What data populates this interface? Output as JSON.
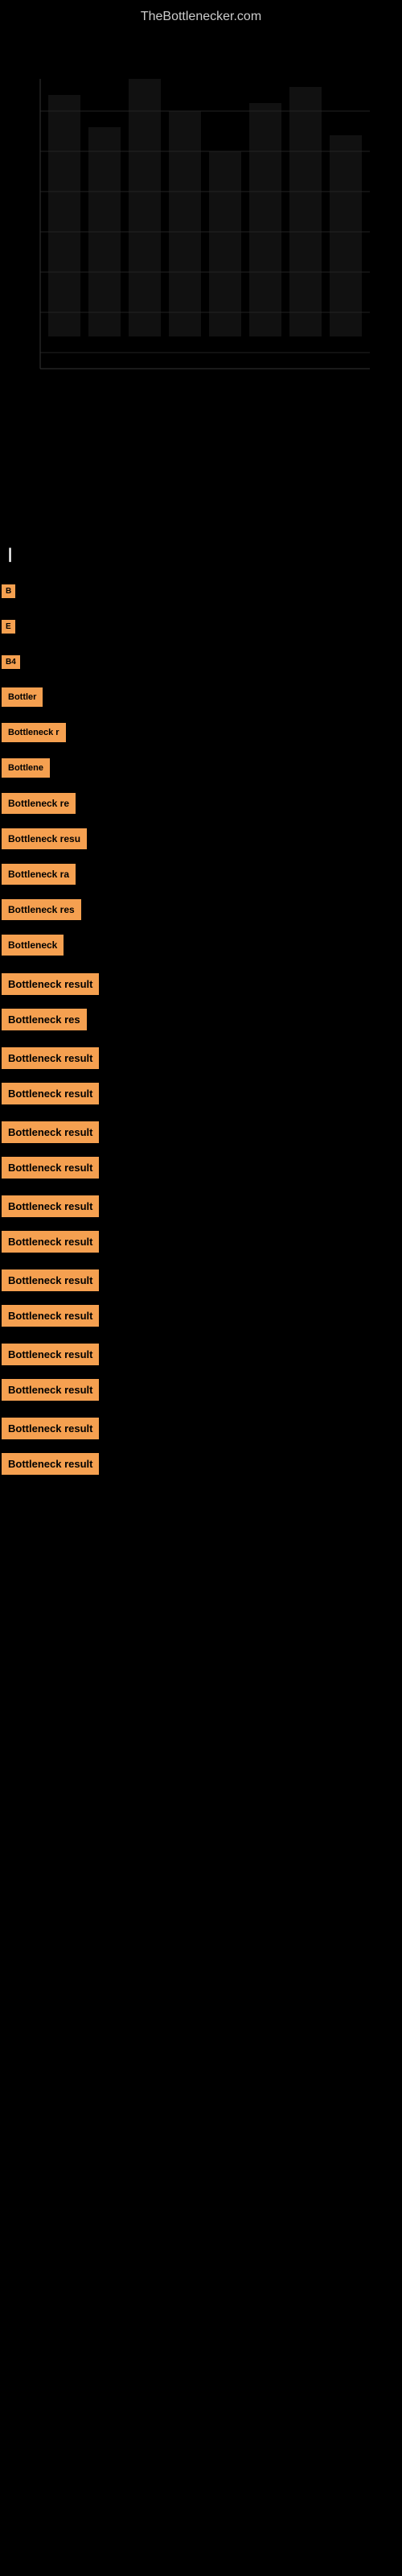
{
  "site": {
    "title": "TheBottlenecker.com"
  },
  "section": {
    "label": "|"
  },
  "bottleneck_rows": [
    {
      "id": 1,
      "label": "B",
      "size": "tiny"
    },
    {
      "id": 2,
      "label": "E",
      "size": "tiny"
    },
    {
      "id": 3,
      "label": "B4",
      "size": "tiny"
    },
    {
      "id": 4,
      "label": "Bottler",
      "size": "small"
    },
    {
      "id": 5,
      "label": "Bottleneck r",
      "size": "small"
    },
    {
      "id": 6,
      "label": "Bottlene",
      "size": "small"
    },
    {
      "id": 7,
      "label": "Bottleneck re",
      "size": "medium"
    },
    {
      "id": 8,
      "label": "Bottleneck resu",
      "size": "medium"
    },
    {
      "id": 9,
      "label": "Bottleneck ra",
      "size": "medium"
    },
    {
      "id": 10,
      "label": "Bottleneck res",
      "size": "medium"
    },
    {
      "id": 11,
      "label": "Bottleneck",
      "size": "medium"
    },
    {
      "id": 12,
      "label": "Bottleneck result",
      "size": "large"
    },
    {
      "id": 13,
      "label": "Bottleneck res",
      "size": "large"
    },
    {
      "id": 14,
      "label": "Bottleneck result",
      "size": "large"
    },
    {
      "id": 15,
      "label": "Bottleneck result",
      "size": "large"
    },
    {
      "id": 16,
      "label": "Bottleneck result",
      "size": "large"
    },
    {
      "id": 17,
      "label": "Bottleneck result",
      "size": "large"
    },
    {
      "id": 18,
      "label": "Bottleneck result",
      "size": "large"
    },
    {
      "id": 19,
      "label": "Bottleneck result",
      "size": "large"
    },
    {
      "id": 20,
      "label": "Bottleneck result",
      "size": "large"
    },
    {
      "id": 21,
      "label": "Bottleneck result",
      "size": "large"
    },
    {
      "id": 22,
      "label": "Bottleneck result",
      "size": "large"
    },
    {
      "id": 23,
      "label": "Bottleneck result",
      "size": "large"
    },
    {
      "id": 24,
      "label": "Bottleneck result",
      "size": "large"
    },
    {
      "id": 25,
      "label": "Bottleneck result",
      "size": "large"
    }
  ]
}
